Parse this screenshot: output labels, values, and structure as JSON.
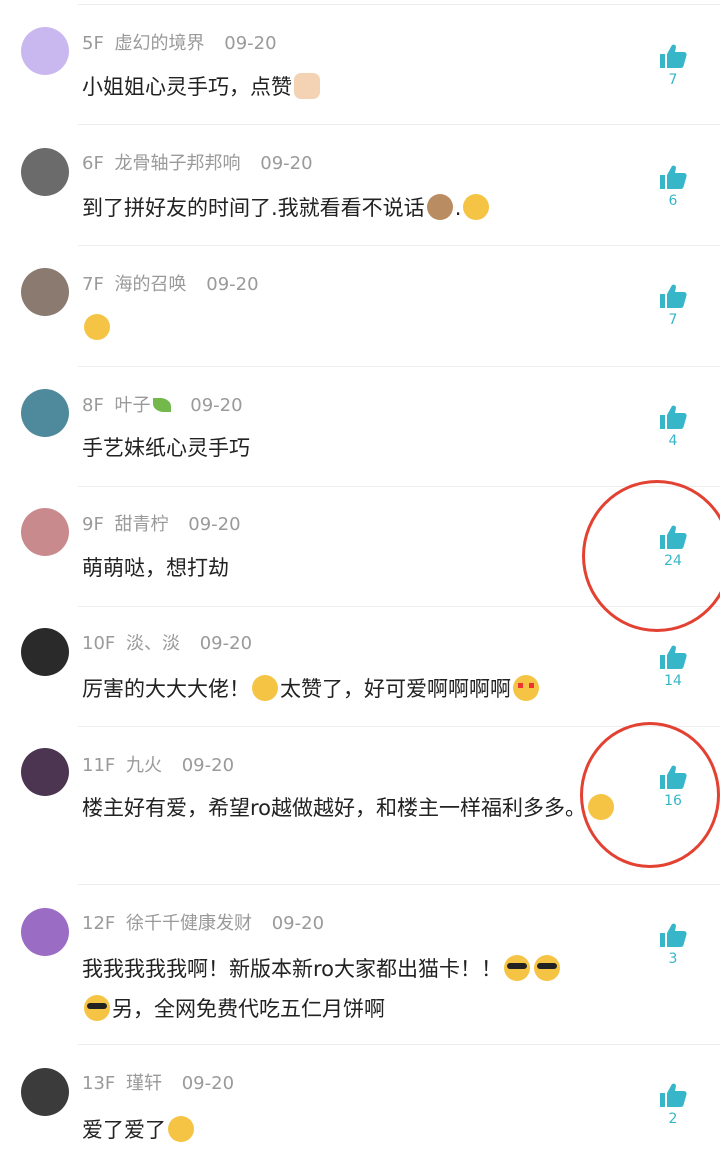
{
  "colors": {
    "accent": "#38b6c9",
    "annotation": "#e34132",
    "meta_text": "#9a9a9a"
  },
  "comments": [
    {
      "floor": "5F",
      "user": "虚幻的境界",
      "date": "09-20",
      "text": "小姐姐心灵手巧，点赞",
      "likes": "7",
      "avatar_color": "#c9b7f0"
    },
    {
      "floor": "6F",
      "user": "龙骨轴子邦邦响",
      "date": "09-20",
      "text": "到了拼好友的时间了.我就看看不说话",
      "text_suffix": ".",
      "likes": "6",
      "avatar_color": "#6b6b6b"
    },
    {
      "floor": "7F",
      "user": "海的召唤",
      "date": "09-20",
      "text": "",
      "likes": "7",
      "avatar_color": "#8a7a70"
    },
    {
      "floor": "8F",
      "user": "叶子",
      "date": "09-20",
      "text": "手艺妹纸心灵手巧",
      "likes": "4",
      "avatar_color": "#4f8a9c"
    },
    {
      "floor": "9F",
      "user": "甜青柠",
      "date": "09-20",
      "text": "萌萌哒，想打劫",
      "likes": "24",
      "avatar_color": "#c98a8e"
    },
    {
      "floor": "10F",
      "user": "淡、淡",
      "date": "09-20",
      "text": "厉害的大大大佬！",
      "text_mid": "太赞了，好可爱啊啊啊啊",
      "likes": "14",
      "avatar_color": "#2a2a2a"
    },
    {
      "floor": "11F",
      "user": "九火",
      "date": "09-20",
      "text": "楼主好有爱，希望ro越做越好，和楼主一样福利多多。",
      "likes": "16",
      "avatar_color": "#4b3550"
    },
    {
      "floor": "12F",
      "user": "徐千千健康发财",
      "date": "09-20",
      "text": "我我我我我啊！新版本新ro大家都出猫卡！！",
      "text_line2": "另，全网免费代吃五仁月饼啊",
      "likes": "3",
      "avatar_color": "#9b6cc4"
    },
    {
      "floor": "13F",
      "user": "瑾轩",
      "date": "09-20",
      "text": "爱了爱了",
      "likes": "2",
      "avatar_color": "#3b3b3b"
    }
  ],
  "icons": {
    "like": "thumbs-up-icon"
  }
}
